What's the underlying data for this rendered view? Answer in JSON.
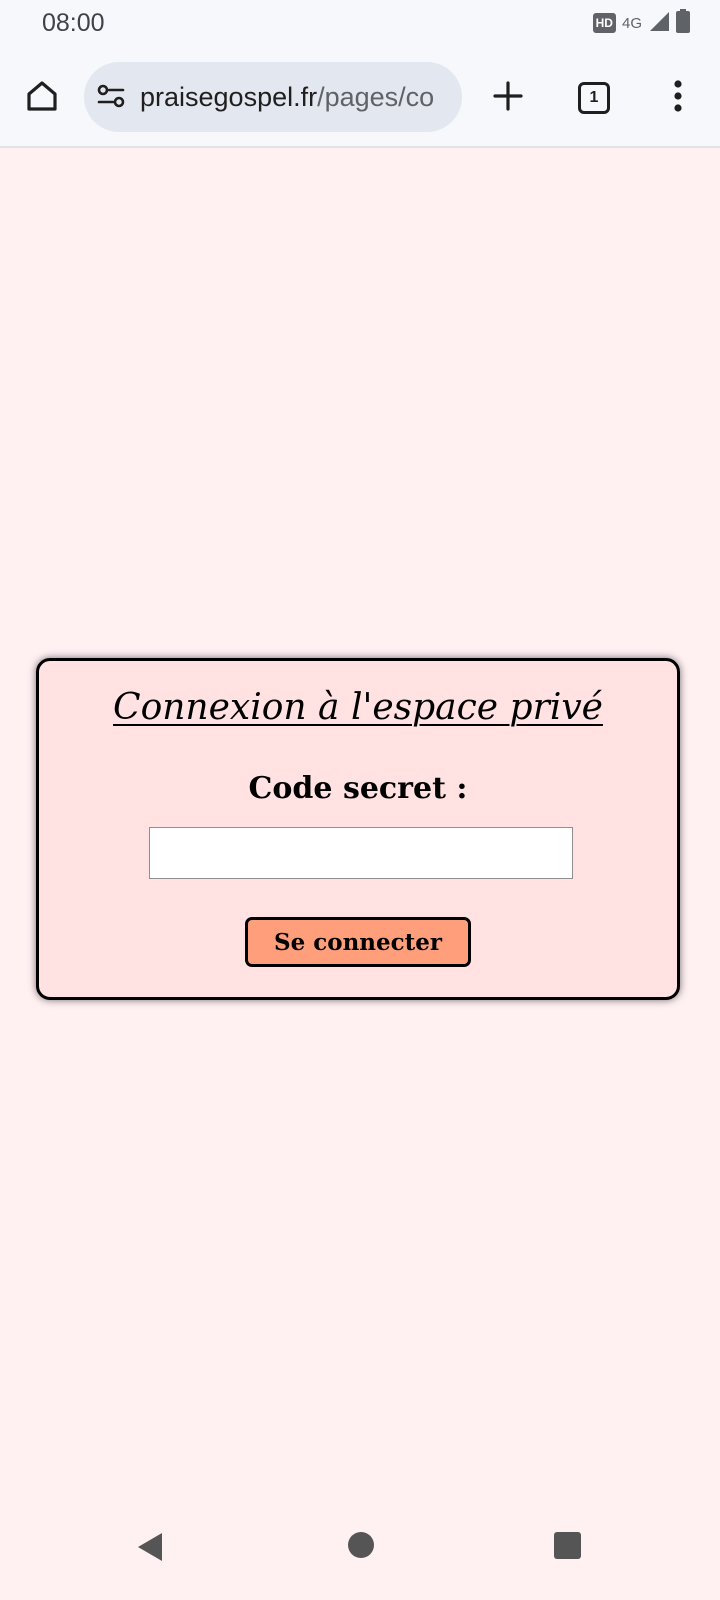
{
  "status_bar": {
    "time": "08:00",
    "hd_badge": "HD",
    "network": "4G"
  },
  "browser": {
    "url_host": "praisegospel.fr",
    "url_path": "/pages/co",
    "tab_count": "1"
  },
  "login": {
    "title": "Connexion à l'espace privé",
    "code_label": "Code secret :",
    "code_value": "",
    "submit_label": "Se connecter"
  },
  "colors": {
    "page_background": "#fff0f2",
    "card_background": "#ffe2e1",
    "button_background": "#ff9e7a",
    "toolbar_background": "#f6f8fc"
  },
  "icons": {
    "home": "home-icon",
    "site_settings": "site-settings-icon",
    "new_tab": "plus-icon",
    "menu": "more-vert-icon",
    "nav_back": "triangle-back-icon",
    "nav_home": "circle-home-icon",
    "nav_recents": "square-recents-icon"
  }
}
